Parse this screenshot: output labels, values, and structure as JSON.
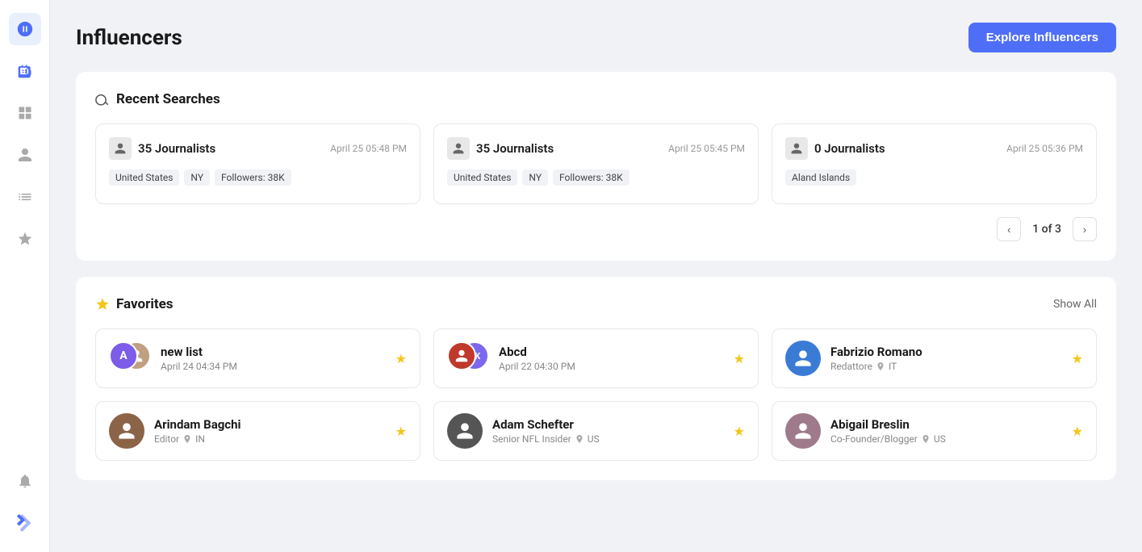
{
  "page": {
    "title": "Influencers",
    "explore_button": "Explore Influencers"
  },
  "sidebar": {
    "icons": [
      {
        "name": "logo-icon",
        "symbol": "✦",
        "active": true
      },
      {
        "name": "robot-icon",
        "symbol": "🤖",
        "active": false
      },
      {
        "name": "grid-icon",
        "symbol": "⊞",
        "active": false
      },
      {
        "name": "contact-icon",
        "symbol": "👤",
        "active": false
      },
      {
        "name": "book-icon",
        "symbol": "📋",
        "active": false
      },
      {
        "name": "star-icon",
        "symbol": "★",
        "active": false
      }
    ],
    "bottom_icons": [
      {
        "name": "bell-icon",
        "symbol": "🔔"
      },
      {
        "name": "logo-bottom-icon",
        "symbol": "✦"
      }
    ]
  },
  "recent_searches": {
    "section_title": "Recent Searches",
    "pagination": {
      "current": "1 of 3",
      "prev_label": "‹",
      "next_label": "›"
    },
    "cards": [
      {
        "count": "35",
        "type": "Journalists",
        "date": "April 25 05:48 PM",
        "tags": [
          "United States",
          "NY",
          "Followers: 38K"
        ]
      },
      {
        "count": "35",
        "type": "Journalists",
        "date": "April 25 05:45 PM",
        "tags": [
          "United States",
          "NY",
          "Followers: 38K"
        ]
      },
      {
        "count": "0",
        "type": "Journalists",
        "date": "April 25 05:36 PM",
        "tags": [
          "Aland Islands"
        ]
      }
    ]
  },
  "favorites": {
    "section_title": "Favorites",
    "show_all_label": "Show All",
    "cards": [
      {
        "id": "new-list",
        "name": "new list",
        "subtitle": "April 24 04:34 PM",
        "type": "list",
        "avatar_initials": [
          "A",
          ""
        ],
        "avatar_colors": [
          "#7c5ce8",
          "#bbb"
        ]
      },
      {
        "id": "abcd",
        "name": "Abcd",
        "subtitle": "April 22 04:30 PM",
        "type": "list",
        "avatar_initials": [
          "",
          "AK"
        ],
        "avatar_colors": [
          "#c0392b",
          "#7b68ee"
        ]
      },
      {
        "id": "fabrizio-romano",
        "name": "Fabrizio Romano",
        "subtitle": "Redattore",
        "location": "IT",
        "type": "person"
      },
      {
        "id": "arindam-bagchi",
        "name": "Arindam Bagchi",
        "subtitle": "Editor",
        "location": "IN",
        "type": "person"
      },
      {
        "id": "adam-schefter",
        "name": "Adam Schefter",
        "subtitle": "Senior NFL Insider",
        "location": "US",
        "type": "person"
      },
      {
        "id": "abigail-breslin",
        "name": "Abigail Breslin",
        "subtitle": "Co-Founder/Blogger",
        "location": "US",
        "type": "person"
      }
    ]
  }
}
